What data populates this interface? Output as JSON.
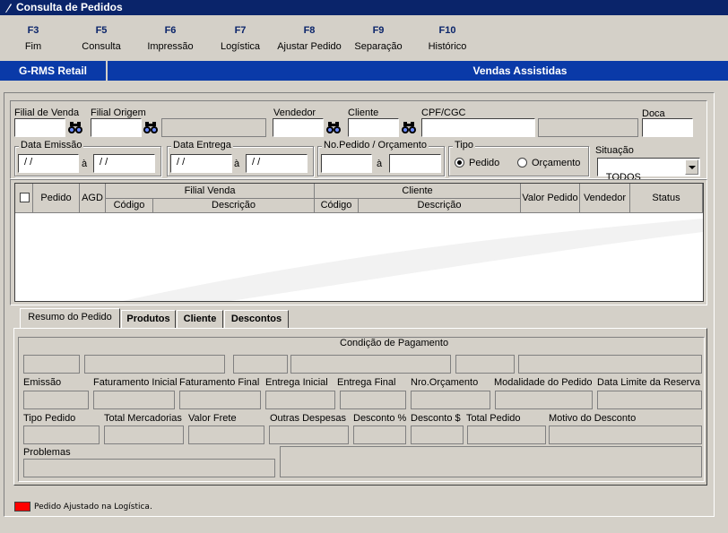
{
  "window": {
    "title": "Consulta de Pedidos"
  },
  "toolbar": [
    {
      "key": "F3",
      "label": "Fim"
    },
    {
      "key": "F5",
      "label": "Consulta"
    },
    {
      "key": "F6",
      "label": "Impressão"
    },
    {
      "key": "F7",
      "label": "Logística"
    },
    {
      "key": "F8",
      "label": "Ajustar Pedido"
    },
    {
      "key": "F9",
      "label": "Separação"
    },
    {
      "key": "F10",
      "label": "Histórico"
    }
  ],
  "banner": {
    "left": "G-RMS Retail",
    "right": "Vendas Assistidas"
  },
  "filters": {
    "filial_venda_label": "Filial de Venda",
    "filial_origem_label": "Filial Origem",
    "vendedor_label": "Vendedor",
    "cliente_label": "Cliente",
    "cpf_label": "CPF/CGC",
    "doca_label": "Doca",
    "data_emissao_label": "Data Emissão",
    "data_entrega_label": "Data Entrega",
    "pedido_orc_label": "No.Pedido / Orçamento",
    "tipo_label": "Tipo",
    "situacao_label": "Situação",
    "ate": "à",
    "date_placeholder": " / /",
    "tipo_options": [
      "Pedido",
      "Orçamento"
    ],
    "tipo_selected": "Pedido",
    "situacao_value": "TODOS"
  },
  "grid": {
    "headers": {
      "pedido": "Pedido",
      "agd": "AGD",
      "filial_venda": "Filial Venda",
      "cliente": "Cliente",
      "codigo": "Código",
      "descricao": "Descrição",
      "valor_pedido": "Valor Pedido",
      "vendedor": "Vendedor",
      "status": "Status"
    },
    "rows": []
  },
  "tabs": [
    {
      "label": "Resumo do Pedido",
      "active": true
    },
    {
      "label": "Produtos",
      "active": false
    },
    {
      "label": "Cliente",
      "active": false
    },
    {
      "label": "Descontos",
      "active": false
    }
  ],
  "resumo": {
    "condicao_pagamento": "Condição de Pagamento",
    "emissao": "Emissão",
    "faturamento_inicial": "Faturamento Inicial",
    "faturamento_final": "Faturamento Final",
    "entrega_inicial": "Entrega Inicial",
    "entrega_final": "Entrega Final",
    "nro_orcamento": "Nro.Orçamento",
    "modalidade": "Modalidade do Pedido",
    "data_limite": "Data Limite da Reserva",
    "tipo_pedido": "Tipo Pedido",
    "total_mercadorias": "Total Mercadorias",
    "valor_frete": "Valor Frete",
    "outras_despesas": "Outras Despesas",
    "desconto_pct": "Desconto %",
    "desconto_valor": "Desconto $",
    "total_pedido": "Total Pedido",
    "motivo_desconto": "Motivo do Desconto",
    "problemas": "Problemas"
  },
  "legend": {
    "text": "Pedido Ajustado na Logística.",
    "color": "#ff0000"
  }
}
